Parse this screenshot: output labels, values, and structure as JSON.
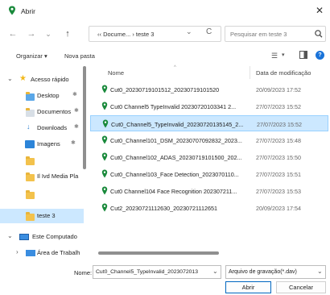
{
  "window": {
    "title": "Abrir",
    "close_glyph": "✕",
    "icon": "map-pin-icon",
    "accent_color": "#1a8a3c"
  },
  "nav": {
    "back_glyph": "←",
    "forward_glyph": "→",
    "recent_glyph": "⌄",
    "up_glyph": "↑",
    "address_path": "‹‹ Docume... › teste 3",
    "address_dropdown_glyph": "⌄",
    "refresh_glyph": "C",
    "search_placeholder": "Pesquisar em teste 3"
  },
  "toolbar": {
    "organize_label": "Organizar ▾",
    "new_folder_label": "Nova pasta",
    "view_glyph": "☰",
    "view_dropdown_glyph": "▾",
    "help_glyph": "?"
  },
  "sidebar": {
    "items": [
      {
        "label": "Acesso rápido",
        "icon": "star-icon",
        "chevron": "⌄",
        "pinned": false
      },
      {
        "label": "Desktop",
        "icon": "folder-icon",
        "chevron": "",
        "pinned": true
      },
      {
        "label": "Documentos",
        "icon": "folder-icon",
        "chevron": "",
        "pinned": true
      },
      {
        "label": "Downloads",
        "icon": "download-icon",
        "chevron": "",
        "pinned": true
      },
      {
        "label": "Imagens",
        "icon": "images-icon",
        "chevron": "",
        "pinned": true
      },
      {
        "label": "",
        "icon": "folder-icon",
        "chevron": "",
        "pinned": false
      },
      {
        "label": "Il Ivd Media Pla",
        "icon": "folder-icon",
        "chevron": "",
        "pinned": false
      },
      {
        "label": "",
        "icon": "folder-icon",
        "chevron": "",
        "pinned": false
      },
      {
        "label": "teste 3",
        "icon": "folder-icon",
        "chevron": "",
        "pinned": false,
        "selected": true
      },
      {
        "label": "Este Computado",
        "icon": "computer-icon",
        "chevron": "⌄",
        "pinned": false
      },
      {
        "label": "Área de Trabalh",
        "icon": "desktop-icon",
        "chevron": "›",
        "pinned": false
      }
    ],
    "pin_glyph": "✱"
  },
  "list": {
    "col_name": "Nome",
    "col_date": "Data de modificação",
    "sort_caret": "^",
    "rows": [
      {
        "name": "Cut0_20230719101512_20230719101520",
        "date": "20/09/2023 17:52",
        "selected": false
      },
      {
        "name": "Cut0 Channel5 TypeInvalid 20230720103341 2...",
        "date": "27/07/2023 15:52",
        "selected": false
      },
      {
        "name": "Cut0_Channel5_TypeInvalid_20230720135145_2...",
        "date": "27/07/2023 15:52",
        "selected": true
      },
      {
        "name": "Cut0_Channel101_DSM_20230707092832_2023...",
        "date": "27/07/2023 15:48",
        "selected": false
      },
      {
        "name": "Cut0_Channel102_ADAS_20230719101500_202...",
        "date": "27/07/2023 15:50",
        "selected": false
      },
      {
        "name": "Cut0_Channel103_Face Detection_2023070110...",
        "date": "27/07/2023 15:51",
        "selected": false
      },
      {
        "name": "Cut0 Channel104 Face Recognition 202307211...",
        "date": "27/07/2023 15:53",
        "selected": false
      },
      {
        "name": "Cut2_20230721112630_20230721112651",
        "date": "20/09/2023 17:54",
        "selected": false
      }
    ]
  },
  "footer": {
    "name_label": "Nome:",
    "name_value": "Cut0_Channel5_TypeInvalid_2023072013",
    "name_dropdown_glyph": "⌄",
    "type_value": "Arquivo de gravação(*.dav)",
    "type_dropdown_glyph": "⌄",
    "open_label": "Abrir",
    "cancel_label": "Cancelar"
  }
}
